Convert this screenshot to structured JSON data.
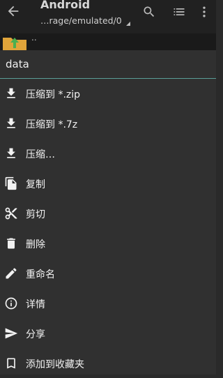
{
  "appbar": {
    "title": "Android",
    "path": "…rage/emulated/0"
  },
  "file_list": {
    "parent_label": ".."
  },
  "sheet": {
    "title": "data",
    "items": [
      {
        "label": "压缩到 *.zip",
        "icon": "download-icon"
      },
      {
        "label": "压缩到 *.7z",
        "icon": "download-icon"
      },
      {
        "label": "压缩…",
        "icon": "download-icon"
      },
      {
        "label": "复制",
        "icon": "copy-icon"
      },
      {
        "label": "剪切",
        "icon": "cut-icon"
      },
      {
        "label": "删除",
        "icon": "delete-icon"
      },
      {
        "label": "重命名",
        "icon": "rename-icon"
      },
      {
        "label": "详情",
        "icon": "info-icon"
      },
      {
        "label": "分享",
        "icon": "share-icon"
      },
      {
        "label": "添加到收藏夹",
        "icon": "bookmark-icon"
      }
    ]
  },
  "colors": {
    "appbar": "#212121",
    "sheet": "#303030",
    "divider": "#5a9e96",
    "folder": "#e0a43a",
    "folder_arrow": "#4caf50"
  }
}
